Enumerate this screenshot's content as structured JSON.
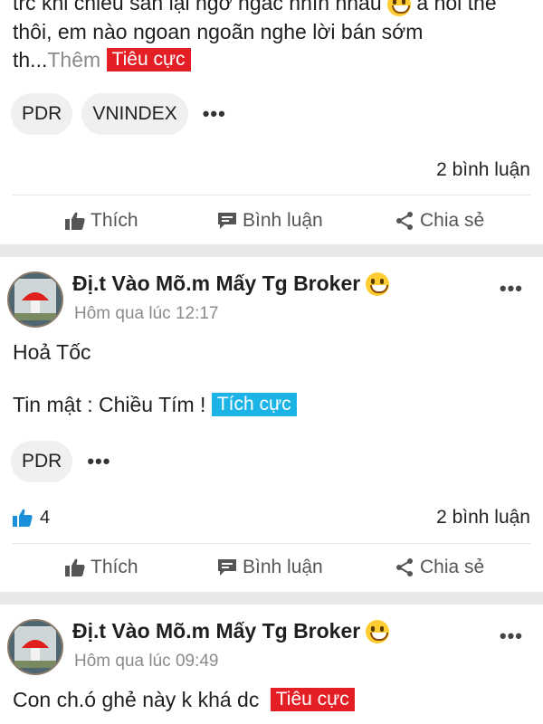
{
  "post1": {
    "line1": "trc khi chiều sàn lại ngỡ ngác nhìn nhau",
    "line1b": "à nói thế",
    "line2": "thôi, em nào ngoan ngoãn nghe lời bán sớm",
    "line3": "th...",
    "more_label": "Thêm",
    "sentiment_label": "Tiêu cực",
    "tags": [
      "PDR",
      "VNINDEX"
    ],
    "more_tags": "•••",
    "comments": "2 bình luận"
  },
  "actions": {
    "like": "Thích",
    "comment": "Bình luận",
    "share": "Chia sẻ"
  },
  "post2": {
    "author": "Đị.t Vào Mõ.m Mấy Tg Broker",
    "time": "Hôm qua lúc 12:17",
    "menu": "•••",
    "line1": "Hoả Tốc",
    "line2": "Tin mật : Chiều Tím !",
    "sentiment_label": "Tích cực",
    "tags": [
      "PDR"
    ],
    "more_tags": "•••",
    "likes": "4",
    "comments": "2 bình luận"
  },
  "post3": {
    "author": "Đị.t Vào Mõ.m Mấy Tg Broker",
    "time": "Hôm qua lúc 09:49",
    "menu": "•••",
    "line1": "Con ch.ó ghẻ này k khá dc",
    "sentiment_label": "Tiêu cực"
  },
  "colors": {
    "negative": "#e31e24",
    "positive": "#1cb3e6",
    "like_blue": "#1a8fdc"
  }
}
